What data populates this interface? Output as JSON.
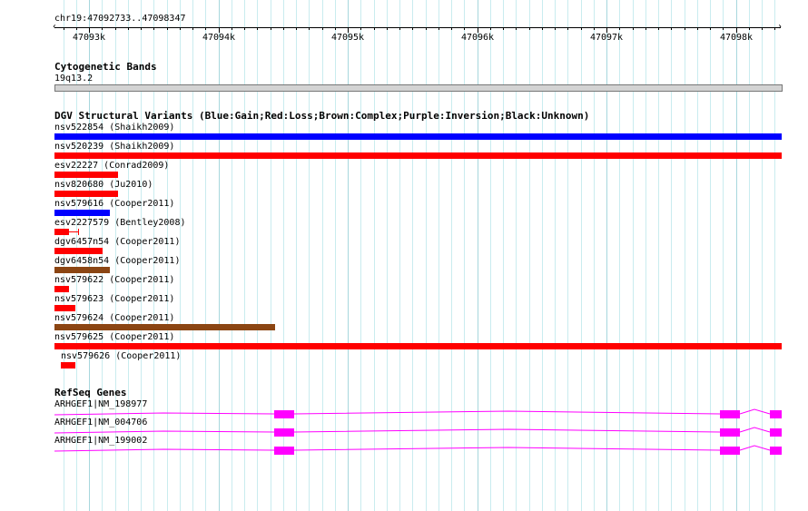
{
  "ruler": {
    "location": "chr19:47092733..47098347",
    "ticks": [
      "47093k",
      "47094k",
      "47095k",
      "47096k",
      "47097k",
      "47098k"
    ]
  },
  "cytoband_track": {
    "title": "Cytogenetic Bands",
    "band_label": "19q13.2"
  },
  "dgv_track": {
    "title": "DGV Structural Variants (Blue:Gain;Red:Loss;Brown:Complex;Purple:Inversion;Black:Unknown)",
    "features": [
      {
        "label": "nsv522854 (Shaikh2009)",
        "type": "Gain",
        "color": "#0000ff"
      },
      {
        "label": "nsv520239 (Shaikh2009)",
        "type": "Loss",
        "color": "#ff0000"
      },
      {
        "label": "esv22227 (Conrad2009)",
        "type": "Loss",
        "color": "#ff0000"
      },
      {
        "label": "nsv820680 (Ju2010)",
        "type": "Loss",
        "color": "#ff0000"
      },
      {
        "label": "nsv579616 (Cooper2011)",
        "type": "Gain",
        "color": "#0000ff"
      },
      {
        "label": "esv2227579 (Bentley2008)",
        "type": "Loss",
        "color": "#ff0000"
      },
      {
        "label": "dgv6457n54 (Cooper2011)",
        "type": "Loss",
        "color": "#ff0000"
      },
      {
        "label": "dgv6458n54 (Cooper2011)",
        "type": "Complex",
        "color": "#8b4513"
      },
      {
        "label": "nsv579622 (Cooper2011)",
        "type": "Loss",
        "color": "#ff0000"
      },
      {
        "label": "nsv579623 (Cooper2011)",
        "type": "Loss",
        "color": "#ff0000"
      },
      {
        "label": "nsv579624 (Cooper2011)",
        "type": "Complex",
        "color": "#8b4513"
      },
      {
        "label": "nsv579625 (Cooper2011)",
        "type": "Loss",
        "color": "#ff0000"
      },
      {
        "label": "nsv579626 (Cooper2011)",
        "type": "Loss",
        "color": "#ff0000"
      }
    ]
  },
  "refseq_track": {
    "title": "RefSeq Genes",
    "color": "#ff00ff",
    "genes": [
      {
        "label": "ARHGEF1|NM_198977"
      },
      {
        "label": "ARHGEF1|NM_004706"
      },
      {
        "label": "ARHGEF1|NM_199002"
      }
    ]
  }
}
